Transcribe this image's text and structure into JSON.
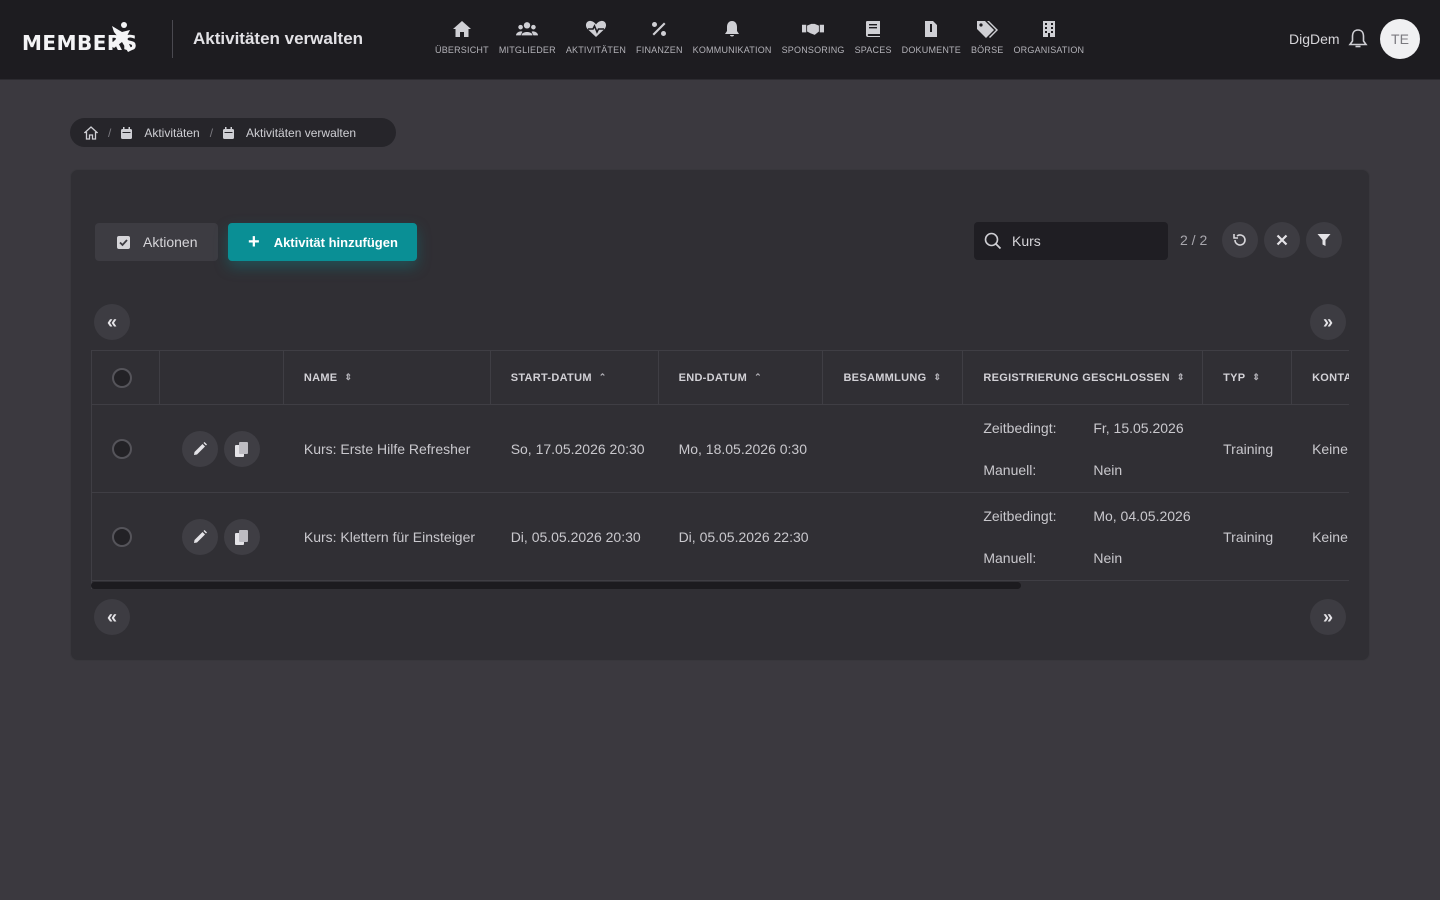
{
  "header": {
    "logo_text": "MEMBERS",
    "title": "Aktivitäten verwalten",
    "nav": [
      {
        "label": "ÜBERSICHT",
        "icon": "home-icon"
      },
      {
        "label": "MITGLIEDER",
        "icon": "users-icon"
      },
      {
        "label": "AKTIVITÄTEN",
        "icon": "heartbeat-icon"
      },
      {
        "label": "FINANZEN",
        "icon": "percent-icon"
      },
      {
        "label": "KOMMUNIKATION",
        "icon": "bell-icon"
      },
      {
        "label": "SPONSORING",
        "icon": "handshake-icon"
      },
      {
        "label": "SPACES",
        "icon": "book-icon"
      },
      {
        "label": "DOKUMENTE",
        "icon": "document-icon"
      },
      {
        "label": "BÖRSE",
        "icon": "tags-icon"
      },
      {
        "label": "ORGANISATION",
        "icon": "building-icon"
      }
    ],
    "user_name": "DigDem",
    "avatar_initials": "TE"
  },
  "breadcrumb": {
    "items": [
      {
        "label": "",
        "icon": "home-icon"
      },
      {
        "label": "Aktivitäten",
        "icon": "calendar-icon"
      },
      {
        "label": "Aktivitäten verwalten",
        "icon": "calendar-icon"
      }
    ],
    "separator": "/"
  },
  "toolbar": {
    "actions_label": "Aktionen",
    "add_label": "Aktivität hinzufügen",
    "search_value": "Kurs",
    "count": "2 / 2"
  },
  "table": {
    "columns": [
      "NAME",
      "START-DATUM",
      "END-DATUM",
      "BESAMMLUNG",
      "REGISTRIERUNG GESCHLOSSEN",
      "TYP",
      "KONTA"
    ],
    "rows": [
      {
        "name": "Kurs: Erste Hilfe Refresher",
        "start": "So, 17.05.2026 20:30",
        "end": "Mo, 18.05.2026 0:30",
        "besammlung": "",
        "reg_timed_label": "Zeitbedingt:",
        "reg_timed_value": "Fr, 15.05.2026",
        "reg_manual_label": "Manuell:",
        "reg_manual_value": "Nein",
        "typ": "Training",
        "kontakt": "Keine"
      },
      {
        "name": "Kurs: Klettern für Einsteiger",
        "start": "Di, 05.05.2026 20:30",
        "end": "Di, 05.05.2026 22:30",
        "besammlung": "",
        "reg_timed_label": "Zeitbedingt:",
        "reg_timed_value": "Mo, 04.05.2026",
        "reg_manual_label": "Manuell:",
        "reg_manual_value": "Nein",
        "typ": "Training",
        "kontakt": "Keine"
      }
    ]
  },
  "colors": {
    "accent": "#0a8f95",
    "background": "#3b393f",
    "topbar": "#1d1c20",
    "card": "#302f34"
  }
}
